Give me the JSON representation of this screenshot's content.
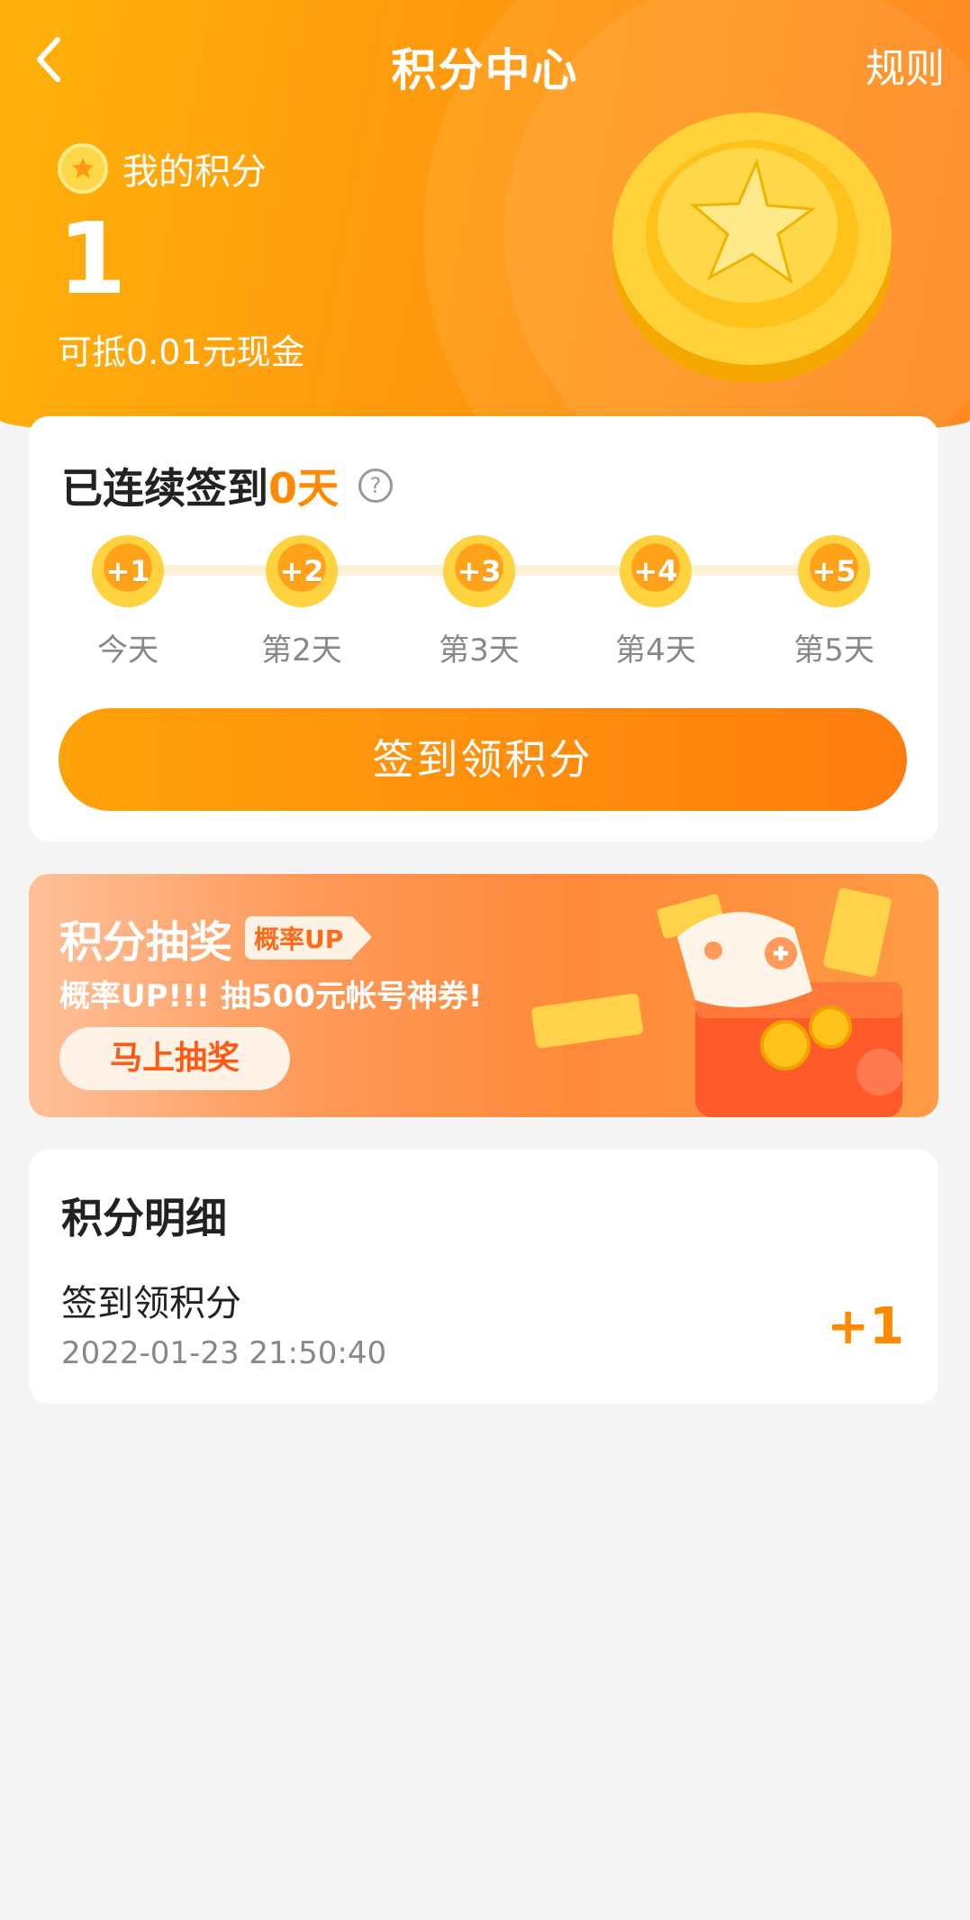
{
  "header": {
    "title": "积分中心",
    "rules_label": "规则"
  },
  "balance": {
    "label": "我的积分",
    "value": "1",
    "cash_text": "可抵0.01元现金"
  },
  "signin": {
    "streak_prefix": "已连续签到",
    "streak_days": "0天",
    "days": [
      {
        "reward": "+1",
        "label": "今天"
      },
      {
        "reward": "+2",
        "label": "第2天"
      },
      {
        "reward": "+3",
        "label": "第3天"
      },
      {
        "reward": "+4",
        "label": "第4天"
      },
      {
        "reward": "+5",
        "label": "第5天"
      }
    ],
    "button_label": "签到领积分"
  },
  "lottery": {
    "title": "积分抽奖",
    "tag": "概率UP",
    "subtitle": "概率UP!!! 抽500元帐号神券!",
    "button_label": "马上抽奖"
  },
  "details": {
    "title": "积分明细",
    "records": [
      {
        "name": "签到领积分",
        "time": "2022-01-23 21:50:40",
        "amount": "+1"
      }
    ]
  },
  "colors": {
    "accent": "#ff8a00",
    "primary_start": "#ffb10a",
    "primary_end": "#ff8012"
  }
}
